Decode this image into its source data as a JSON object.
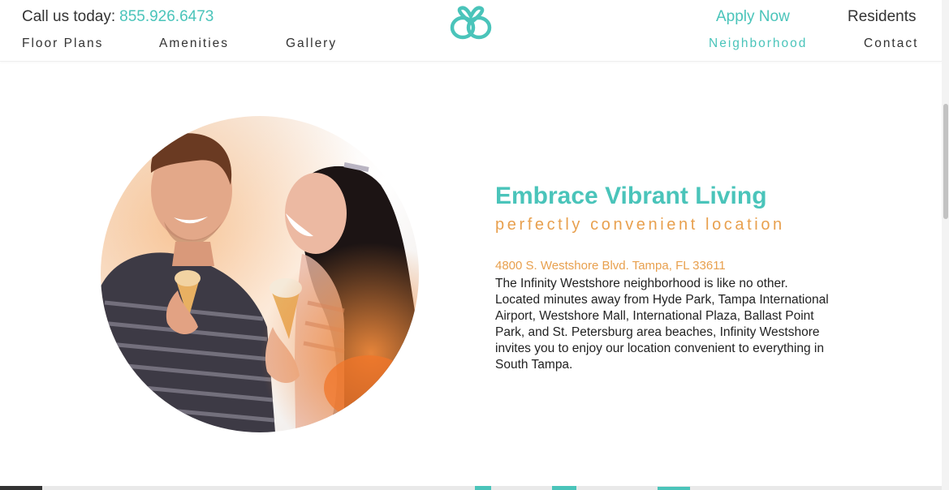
{
  "header": {
    "call_label": "Call us today:",
    "phone": "855.926.6473",
    "apply": "Apply Now",
    "residents": "Residents",
    "nav": {
      "floor_plans": "Floor Plans",
      "amenities": "Amenities",
      "gallery": "Gallery",
      "neighborhood": "Neighborhood",
      "contact": "Contact"
    },
    "logo_icon": "interlocking-loops-logo-icon"
  },
  "content": {
    "heading": "Embrace Vibrant Living",
    "subheading": "perfectly convenient location",
    "address": "4800 S. Westshore Blvd. Tampa, FL 33611",
    "description": "The Infinity Westshore neighborhood is like no other. Located minutes away from Hyde Park, Tampa International Airport, Westshore Mall, International Plaza, Ballast Point Park, and St. Petersburg area beaches, Infinity Westshore invites you to enjoy our location convenient to everything in South Tampa."
  },
  "colors": {
    "accent": "#4ac4ba",
    "orange": "#e8a04e",
    "text": "#222222"
  }
}
